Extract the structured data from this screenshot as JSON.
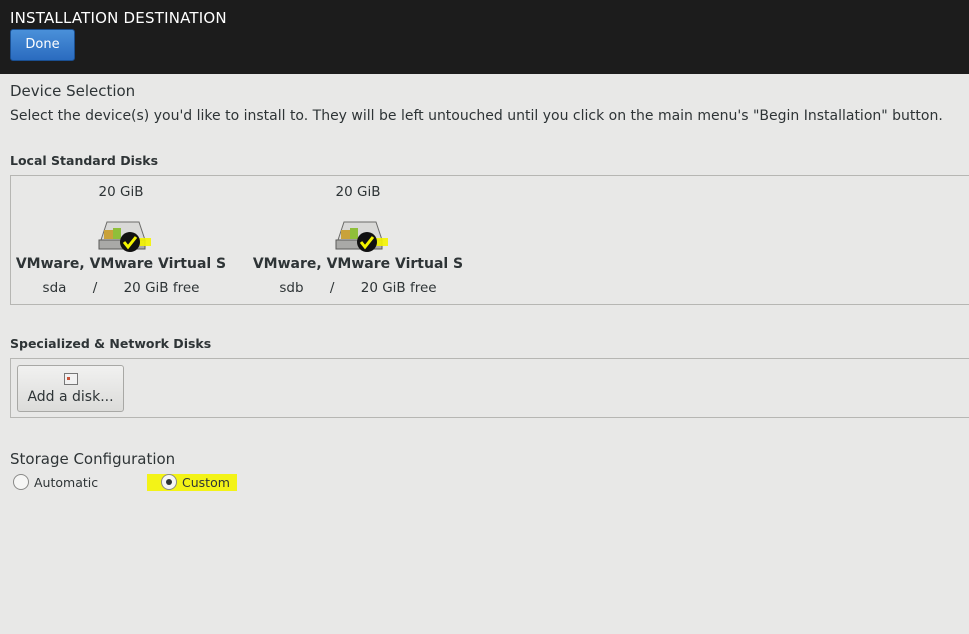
{
  "header": {
    "title": "INSTALLATION DESTINATION",
    "done_label": "Done"
  },
  "device_selection": {
    "title": "Device Selection",
    "description": "Select the device(s) you'd like to install to.  They will be left untouched until you click on the main menu's \"Begin Installation\" button."
  },
  "local_disks": {
    "label": "Local Standard Disks",
    "disks": [
      {
        "size": "20 GiB",
        "name": "VMware, VMware Virtual S",
        "device": "sda",
        "separator": "/",
        "free": "20 GiB free",
        "selected": true
      },
      {
        "size": "20 GiB",
        "name": "VMware, VMware Virtual S",
        "device": "sdb",
        "separator": "/",
        "free": "20 GiB free",
        "selected": true
      }
    ]
  },
  "network_disks": {
    "label": "Specialized & Network Disks",
    "add_label": "Add a disk..."
  },
  "storage": {
    "title": "Storage Configuration",
    "options": [
      {
        "label": "Automatic",
        "checked": false
      },
      {
        "label": "Custom",
        "checked": true
      }
    ]
  },
  "colors": {
    "topbar": "#1c1c1c",
    "done_button": "#2a6bbf",
    "highlight": "#f4f400",
    "background": "#e8e8e7"
  },
  "icons": [
    "hard-disk-icon",
    "checkmark-badge-icon",
    "disk-small-icon"
  ]
}
